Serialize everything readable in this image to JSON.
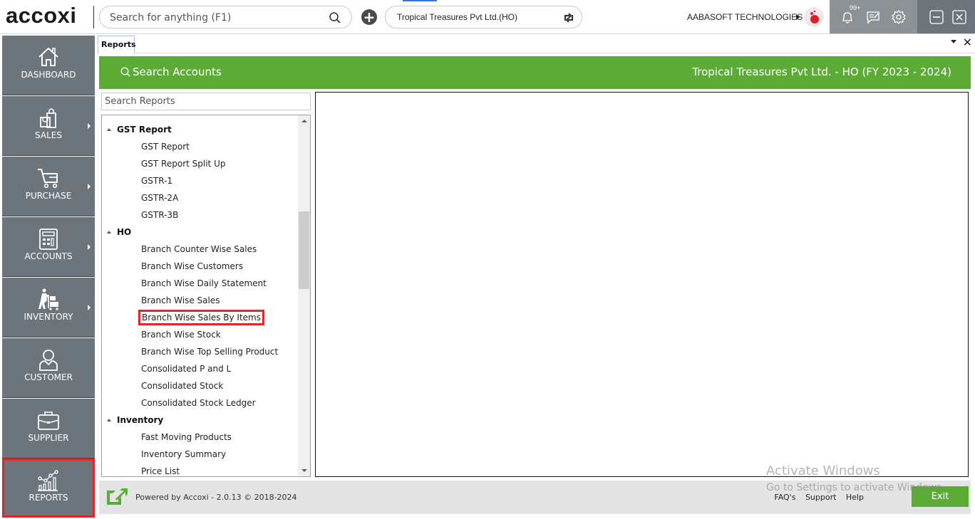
{
  "topbar": {
    "logo": "accoxi",
    "search_placeholder": "Search for anything (F1)",
    "company_selector": "Tropical Treasures Pvt Ltd.(HO)",
    "organization": "AABASOFT TECHNOLOGIES",
    "notification_badge": "99+",
    "icons": [
      "search-icon",
      "add-icon",
      "refresh-icon",
      "bell-icon",
      "message-icon",
      "gear-icon",
      "minimize-icon",
      "close-icon"
    ]
  },
  "sidebar": {
    "items": [
      {
        "label": "DASHBOARD",
        "icon": "home-icon",
        "has_submenu": false
      },
      {
        "label": "SALES",
        "icon": "shopping-bag-icon",
        "has_submenu": true
      },
      {
        "label": "PURCHASE",
        "icon": "cart-icon",
        "has_submenu": true
      },
      {
        "label": "ACCOUNTS",
        "icon": "calculator-icon",
        "has_submenu": true
      },
      {
        "label": "INVENTORY",
        "icon": "inventory-worker-icon",
        "has_submenu": true
      },
      {
        "label": "CUSTOMER",
        "icon": "person-icon",
        "has_submenu": false
      },
      {
        "label": "SUPPLIER",
        "icon": "briefcase-icon",
        "has_submenu": false
      },
      {
        "label": "REPORTS",
        "icon": "chart-icon",
        "has_submenu": false,
        "active": true
      }
    ]
  },
  "tabs": [
    {
      "label": "Reports",
      "active": true
    }
  ],
  "header": {
    "search_accounts": "Search Accounts",
    "company_title": "Tropical Treasures Pvt Ltd. - HO (FY 2023 - 2024)"
  },
  "reports": {
    "search_placeholder": "Search Reports",
    "groups": [
      {
        "name": "GST Report",
        "items": [
          "GST Report",
          "GST Report Split Up",
          "GSTR-1",
          "GSTR-2A",
          "GSTR-3B"
        ]
      },
      {
        "name": "HO",
        "items": [
          "Branch Counter Wise Sales",
          "Branch Wise Customers",
          "Branch Wise Daily Statement",
          "Branch Wise Sales",
          "Branch Wise Sales By Items",
          "Branch Wise Stock",
          "Branch Wise Top Selling Product",
          "Consolidated P and L",
          "Consolidated Stock",
          "Consolidated Stock Ledger"
        ]
      },
      {
        "name": "Inventory",
        "items": [
          "Fast Moving Products",
          "Inventory Summary",
          "Price List"
        ]
      }
    ],
    "highlighted_item": "Branch Wise Sales By Items"
  },
  "footer": {
    "powered_by": "Powered by Accoxi - 2.0.13 © 2018-2024",
    "links": [
      "FAQ's",
      "Support",
      "Help"
    ],
    "exit_label": "Exit"
  },
  "watermark": {
    "line1": "Activate Windows",
    "line2": "Go to Settings to activate Windows."
  },
  "colors": {
    "brand_green": "#5dab37",
    "sidebar_bg": "#6d757c",
    "highlight_red": "#e3242b"
  }
}
